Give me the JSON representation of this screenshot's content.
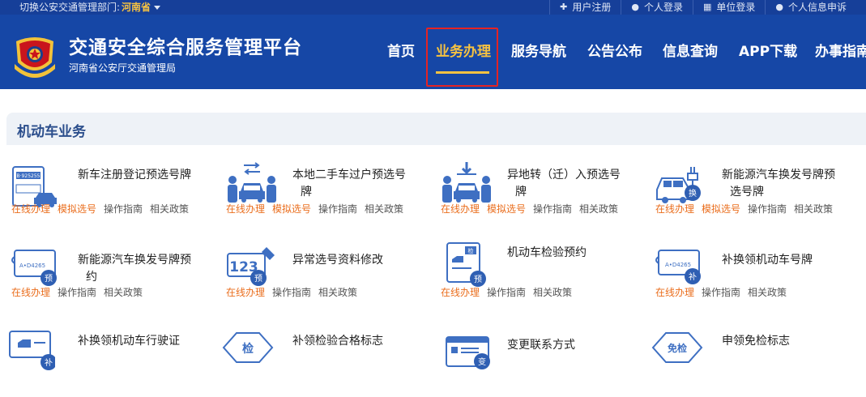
{
  "topbar": {
    "switch_label": "切换公安交通管理部门:",
    "province": "河南省",
    "links": [
      {
        "label": "用户注册",
        "icon": "plus-icon"
      },
      {
        "label": "个人登录",
        "icon": "user-icon"
      },
      {
        "label": "单位登录",
        "icon": "building-icon"
      },
      {
        "label": "个人信息申诉",
        "icon": "user-icon"
      }
    ]
  },
  "header": {
    "title": "交通安全综合服务管理平台",
    "subtitle": "河南省公安厅交通管理局",
    "colors": {
      "primary": "#1647a6",
      "accent": "#f5c242",
      "highlight": "#e52323"
    }
  },
  "nav": {
    "items": [
      "首页",
      "业务办理",
      "服务导航",
      "公告公布",
      "信息查询",
      "APP下载",
      "办事指南"
    ],
    "active_index": 1
  },
  "section": {
    "title": "机动车业务"
  },
  "services": [
    {
      "name": "新车注册登记预选号牌",
      "icon": "plate-card-car-icon",
      "links": [
        "在线办理",
        "模拟选号",
        "操作指南",
        "相关政策"
      ]
    },
    {
      "name": "本地二手车过户预选号牌",
      "icon": "car-transfer-people-icon",
      "links": [
        "在线办理",
        "模拟选号",
        "操作指南",
        "相关政策"
      ]
    },
    {
      "name": "异地转（迁）入预选号牌",
      "icon": "car-relocate-in-icon",
      "links": [
        "在线办理",
        "模拟选号",
        "操作指南",
        "相关政策"
      ]
    },
    {
      "name": "新能源汽车换发号牌预选号牌",
      "icon": "ev-car-exchange-icon",
      "links": [
        "在线办理",
        "模拟选号",
        "操作指南",
        "相关政策"
      ]
    },
    {
      "name": "新能源汽车换发号牌预约",
      "icon": "ev-plate-reserve-icon",
      "links": [
        "在线办理",
        "操作指南",
        "相关政策"
      ]
    },
    {
      "name": "异常选号资料修改",
      "icon": "plate-123-edit-icon",
      "links": [
        "在线办理",
        "操作指南",
        "相关政策"
      ]
    },
    {
      "name": "机动车检验预约",
      "icon": "inspection-document-icon",
      "links": [
        "在线办理",
        "操作指南",
        "相关政策"
      ]
    },
    {
      "name": "补换领机动车号牌",
      "icon": "plate-reissue-icon",
      "links": [
        "在线办理",
        "操作指南",
        "相关政策"
      ]
    },
    {
      "name": "补换领机动车行驶证",
      "icon": "license-reissue-icon",
      "links": []
    },
    {
      "name": "补领检验合格标志",
      "icon": "inspection-badge-icon",
      "links": []
    },
    {
      "name": "变更联系方式",
      "icon": "contact-change-icon",
      "links": []
    },
    {
      "name": "申领免检标志",
      "icon": "exempt-badge-icon",
      "links": []
    }
  ],
  "badges": {
    "pre": "预",
    "exchange": "换",
    "reissue": "补",
    "check": "检",
    "change": "变",
    "exempt": "免检",
    "plate_a": "B·925255",
    "plate_b": "A•D4265",
    "num123": "123"
  }
}
